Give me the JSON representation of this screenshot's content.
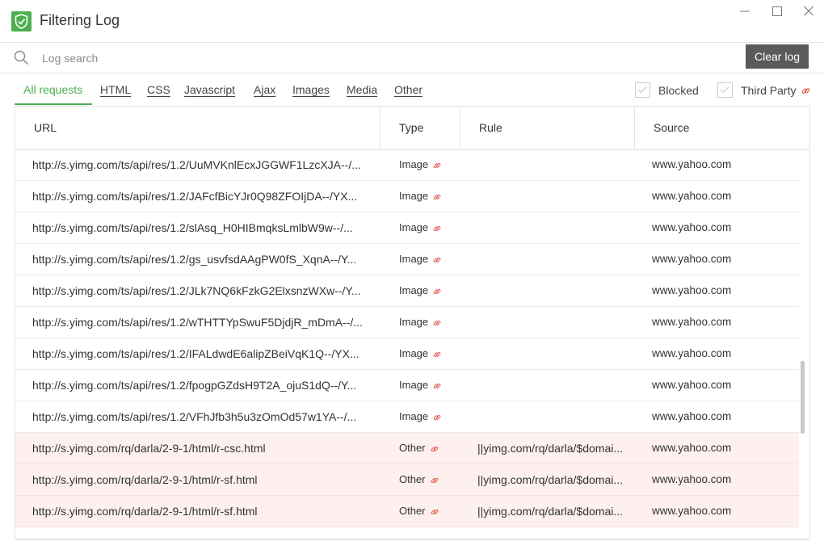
{
  "window": {
    "title": "Filtering Log"
  },
  "search": {
    "placeholder": "Log search",
    "value": ""
  },
  "toolbar": {
    "clear_label": "Clear log"
  },
  "tabs": [
    {
      "label": "All requests",
      "active": true
    },
    {
      "label": "HTML"
    },
    {
      "label": "CSS"
    },
    {
      "label": "Javascript"
    },
    {
      "label": "Ajax"
    },
    {
      "label": "Images"
    },
    {
      "label": "Media"
    },
    {
      "label": "Other"
    }
  ],
  "filters": {
    "blocked_label": "Blocked",
    "third_party_label": "Third Party"
  },
  "table": {
    "headers": {
      "url": "URL",
      "type": "Type",
      "rule": "Rule",
      "source": "Source"
    },
    "rows": [
      {
        "url": "http://s.yimg.com/ts/api/res/1.2/UuMVKnlEcxJGGWF1LzcXJA--/...",
        "type": "Image",
        "rule": "",
        "source": "www.yahoo.com",
        "blocked": false
      },
      {
        "url": "http://s.yimg.com/ts/api/res/1.2/JAFcfBicYJr0Q98ZFOIjDA--/YX...",
        "type": "Image",
        "rule": "",
        "source": "www.yahoo.com",
        "blocked": false
      },
      {
        "url": "http://s.yimg.com/ts/api/res/1.2/slAsq_H0HIBmqksLmlbW9w--/...",
        "type": "Image",
        "rule": "",
        "source": "www.yahoo.com",
        "blocked": false
      },
      {
        "url": "http://s.yimg.com/ts/api/res/1.2/gs_usvfsdAAgPW0fS_XqnA--/Y...",
        "type": "Image",
        "rule": "",
        "source": "www.yahoo.com",
        "blocked": false
      },
      {
        "url": "http://s.yimg.com/ts/api/res/1.2/JLk7NQ6kFzkG2ElxsnzWXw--/Y...",
        "type": "Image",
        "rule": "",
        "source": "www.yahoo.com",
        "blocked": false
      },
      {
        "url": "http://s.yimg.com/ts/api/res/1.2/wTHTTYpSwuF5DjdjR_mDmA--/...",
        "type": "Image",
        "rule": "",
        "source": "www.yahoo.com",
        "blocked": false
      },
      {
        "url": "http://s.yimg.com/ts/api/res/1.2/IFALdwdE6alipZBeiVqK1Q--/YX...",
        "type": "Image",
        "rule": "",
        "source": "www.yahoo.com",
        "blocked": false
      },
      {
        "url": "http://s.yimg.com/ts/api/res/1.2/fpogpGZdsH9T2A_ojuS1dQ--/Y...",
        "type": "Image",
        "rule": "",
        "source": "www.yahoo.com",
        "blocked": false
      },
      {
        "url": "http://s.yimg.com/ts/api/res/1.2/VFhJfb3h5u3zOmOd57w1YA--/...",
        "type": "Image",
        "rule": "",
        "source": "www.yahoo.com",
        "blocked": false
      },
      {
        "url": "http://s.yimg.com/rq/darla/2-9-1/html/r-csc.html",
        "type": "Other",
        "rule": "||yimg.com/rq/darla/$domai...",
        "source": "www.yahoo.com",
        "blocked": true
      },
      {
        "url": "http://s.yimg.com/rq/darla/2-9-1/html/r-sf.html",
        "type": "Other",
        "rule": "||yimg.com/rq/darla/$domai...",
        "source": "www.yahoo.com",
        "blocked": true
      },
      {
        "url": "http://s.yimg.com/rq/darla/2-9-1/html/r-sf.html",
        "type": "Other",
        "rule": "||yimg.com/rq/darla/$domai...",
        "source": "www.yahoo.com",
        "blocked": true
      }
    ]
  },
  "icons": {
    "app": "adguard-shield-icon",
    "search": "search-icon",
    "third_party": "link-icon",
    "minimize": "minimize-icon",
    "maximize": "maximize-icon",
    "close": "close-icon"
  },
  "colors": {
    "accent": "#4caf50",
    "third_party_link": "#e05a4f",
    "blocked_row": "#fdf0ef",
    "clear_button": "#5a5a5a"
  }
}
